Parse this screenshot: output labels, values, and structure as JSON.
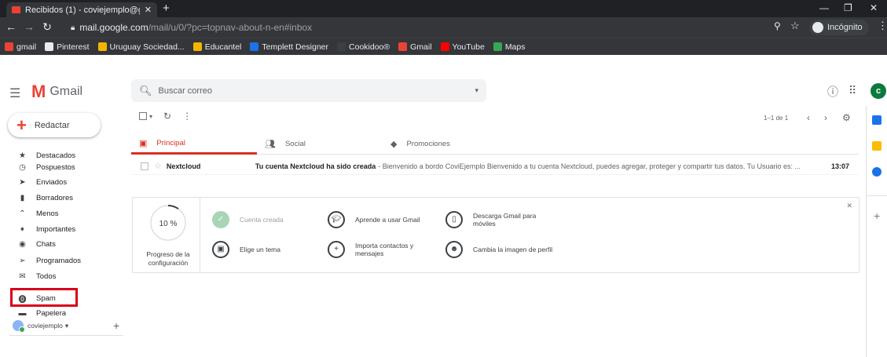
{
  "browser": {
    "tab_title": "Recibidos (1) - coviejemplo@gm",
    "url_domain": "mail.google.com",
    "url_path": "/mail/u/0/?pc=topnav-about-n-en#inbox",
    "incognito_label": "Incógnito"
  },
  "bookmarks": [
    {
      "label": "gmail",
      "color": "#ea4335"
    },
    {
      "label": "Pinterest",
      "color": "#e8eaed"
    },
    {
      "label": "Uruguay Sociedad...",
      "color": "#f4b400"
    },
    {
      "label": "Educantel",
      "color": "#f4b400"
    },
    {
      "label": "Templett Designer",
      "color": "#1a73e8"
    },
    {
      "label": "Cookidoo®",
      "color": "#3c4043"
    },
    {
      "label": "Gmail",
      "color": "#ea4335"
    },
    {
      "label": "YouTube",
      "color": "#ff0000"
    },
    {
      "label": "Maps",
      "color": "#34a853"
    }
  ],
  "gmail": {
    "logo_text": "Gmail",
    "search_placeholder": "Buscar correo",
    "avatar_letter": "c",
    "compose_label": "Redactar"
  },
  "sidebar": {
    "items": [
      {
        "label": "Destacados",
        "icon": "star-icon"
      },
      {
        "label": "Pospuestos",
        "icon": "clock-icon"
      },
      {
        "label": "Enviados",
        "icon": "send-icon"
      },
      {
        "label": "Borradores",
        "icon": "draft-icon"
      },
      {
        "label": "Menos",
        "icon": "chevron-up-icon"
      },
      {
        "label": "Importantes",
        "icon": "important-icon"
      },
      {
        "label": "Chats",
        "icon": "chat-icon"
      },
      {
        "label": "Programados",
        "icon": "schedule-icon"
      },
      {
        "label": "Todos",
        "icon": "mail-icon"
      },
      {
        "label": "Spam",
        "icon": "spam-icon"
      },
      {
        "label": "Papelera",
        "icon": "trash-icon"
      }
    ],
    "user": "coviejemplo"
  },
  "mailbox": {
    "pager_text": "1–1 de 1",
    "tabs": [
      "Principal",
      "Social",
      "Promociones"
    ],
    "rows": [
      {
        "from": "Nextcloud",
        "subject": "Tu cuenta Nextcloud ha sido creada",
        "snippet": "- Bienvenido a bordo CoviEjemplo Bienvenido a tu cuenta Nextcloud, puedes agregar, proteger y compartir tus datos. Tu Usuario es: ...",
        "time": "13:07"
      }
    ]
  },
  "setup": {
    "progress_fraction": 0.1,
    "progress_text": "10 %",
    "progress_label": "Progreso de la configuración",
    "steps": [
      {
        "label": "Cuenta creada",
        "done": true
      },
      {
        "label": "Aprende a usar Gmail",
        "done": false
      },
      {
        "label": "Descarga Gmail para móviles",
        "done": false
      },
      {
        "label": "Elige un tema",
        "done": false
      },
      {
        "label": "Importa contactos y mensajes",
        "done": false
      },
      {
        "label": "Cambia la imagen de perfil",
        "done": false
      }
    ]
  }
}
